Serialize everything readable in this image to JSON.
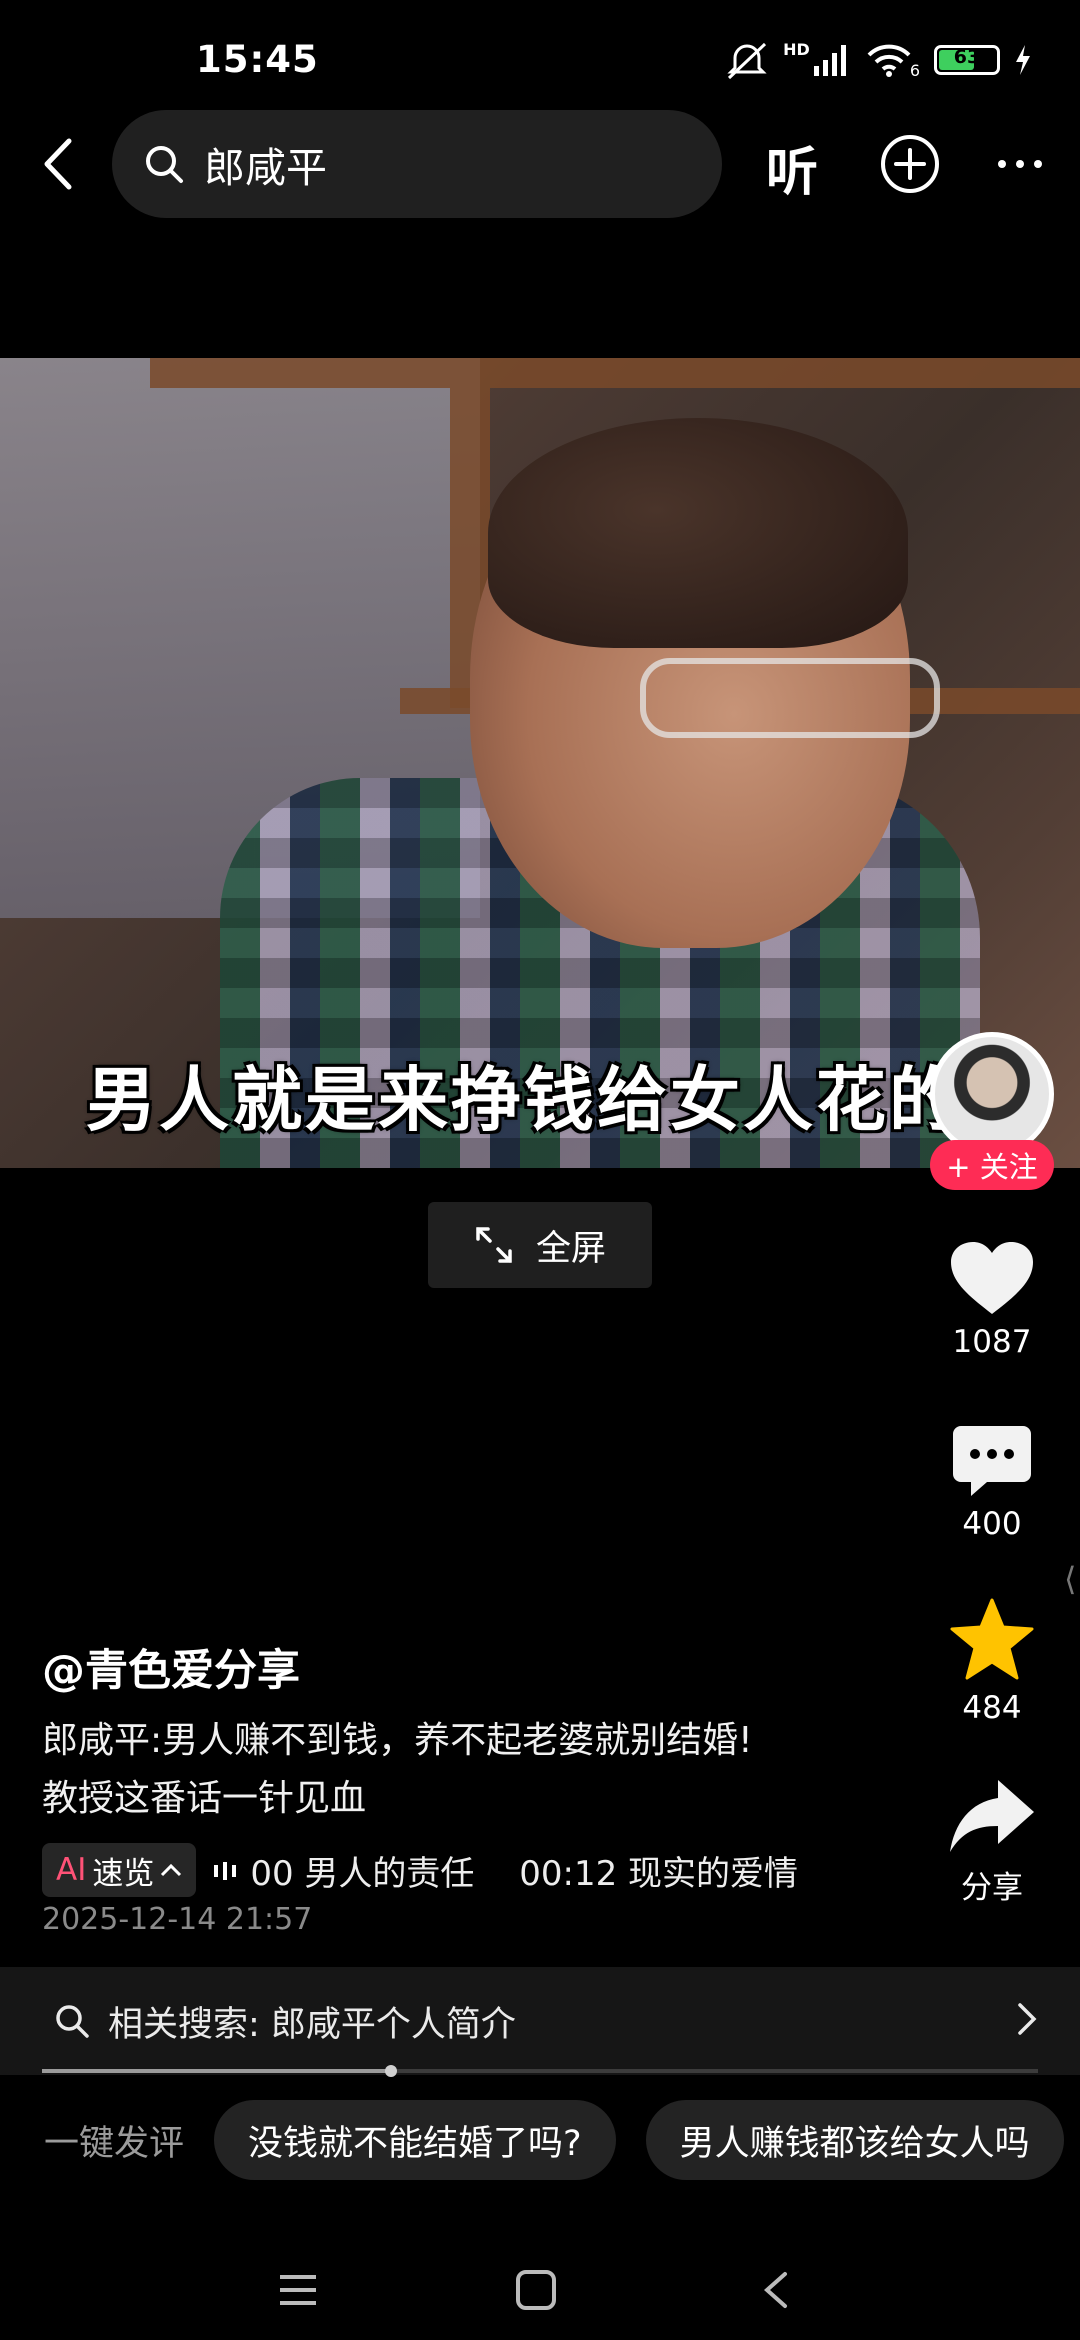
{
  "status_bar": {
    "time": "15:45",
    "battery": "63",
    "network": "HD",
    "wifi_badge": "6"
  },
  "top_nav": {
    "search_query": "郎咸平",
    "listen_label": "听"
  },
  "video": {
    "subtitle": "男人就是来挣钱给女人花的",
    "fullscreen_label": "全屏"
  },
  "right_rail": {
    "follow_label": "+ 关注",
    "likes": "1087",
    "comments": "400",
    "favorites": "484",
    "share_label": "分享"
  },
  "post": {
    "author": "@青色爱分享",
    "description_line1": "郎咸平:男人赚不到钱，养不起老婆就别结婚!",
    "description_line2": "教授这番话一针见血",
    "ai_chip_ai": "AI",
    "ai_chip_label": "速览",
    "chapters": "00 男人的责任　 00:12 现实的爱情",
    "timestamp": "2025-12-14 21:57"
  },
  "related_search": {
    "label": "相关搜索: 郎咸平个人简介"
  },
  "playback": {
    "progress": 0.35
  },
  "quick_comments": {
    "label": "一键发评",
    "chips": [
      "没钱就不能结婚了吗?",
      "男人赚钱都该给女人吗"
    ]
  },
  "colors": {
    "accent": "#fe2c55",
    "favorite": "#ffc300",
    "background": "#000000"
  }
}
